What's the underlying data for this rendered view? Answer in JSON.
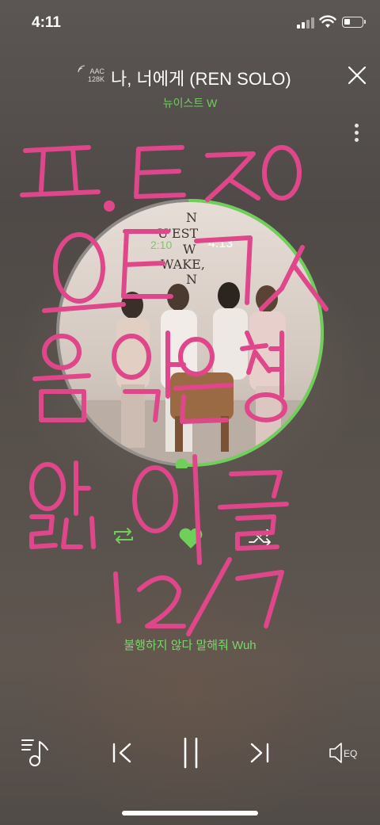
{
  "status_bar": {
    "time": "4:11"
  },
  "header": {
    "codec": "AAC",
    "bitrate": "128K",
    "song_title": "나, 너에게 (REN SOLO)",
    "artist": "뉴이스트 W"
  },
  "album": {
    "cover_text": [
      "N",
      "U'EST",
      "W",
      "WAKE,",
      "N"
    ]
  },
  "playback": {
    "elapsed": "2:10",
    "total": "4:13",
    "progress": 0.51,
    "liked": true,
    "state": "playing"
  },
  "lyric": {
    "current_line": "불행하지 않다 말해줘 Wuh"
  },
  "controls": {
    "eq_label": "EQ"
  },
  "colors": {
    "accent": "#6fcf5a",
    "doodle": "#e0468a",
    "background": "#595350"
  },
  "handwriting": {
    "lines": [
      "ㅍ.ㅌㅈㅇ",
      "ㅇㅌㄱㅅ",
      "음악은행",
      "앓이글",
      "12/7"
    ]
  }
}
